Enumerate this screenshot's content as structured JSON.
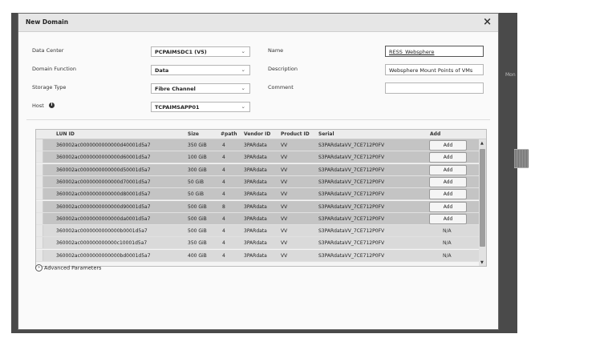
{
  "backdrop": {
    "text_right_top": "Mon"
  },
  "dialog": {
    "title": "New Domain",
    "close_label": "×",
    "form": {
      "data_center": {
        "label": "Data Center",
        "value": "PCPAIMSDC1 (V5)"
      },
      "domain_function": {
        "label": "Domain Function",
        "value": "Data"
      },
      "storage_type": {
        "label": "Storage Type",
        "value": "Fibre Channel"
      },
      "host": {
        "label": "Host",
        "value": "TCPAIMSAPP01"
      },
      "name": {
        "label": "Name",
        "value": "RESS_Websphere"
      },
      "description": {
        "label": "Description",
        "value": "Websphere Mount Points of VMs"
      },
      "comment": {
        "label": "Comment",
        "value": ""
      }
    },
    "lun_table": {
      "columns": [
        "LUN ID",
        "Size",
        "#path",
        "Vendor ID",
        "Product ID",
        "Serial",
        "Add"
      ],
      "rows": [
        {
          "lun_id": "360002ac0000000000000d40001d5a7",
          "size": "350 GiB",
          "paths": "4",
          "vendor": "3PARdata",
          "product": "VV",
          "serial": "S3PARdataVV_7CE712P0FV",
          "add": "Add",
          "addable": true
        },
        {
          "lun_id": "360002ac0000000000000d60001d5a7",
          "size": "100 GiB",
          "paths": "4",
          "vendor": "3PARdata",
          "product": "VV",
          "serial": "S3PARdataVV_7CE712P0FV",
          "add": "Add",
          "addable": true
        },
        {
          "lun_id": "360002ac0000000000000d50001d5a7",
          "size": "300 GiB",
          "paths": "4",
          "vendor": "3PARdata",
          "product": "VV",
          "serial": "S3PARdataVV_7CE712P0FV",
          "add": "Add",
          "addable": true
        },
        {
          "lun_id": "360002ac0000000000000d70001d5a7",
          "size": "50 GiB",
          "paths": "4",
          "vendor": "3PARdata",
          "product": "VV",
          "serial": "S3PARdataVV_7CE712P0FV",
          "add": "Add",
          "addable": true
        },
        {
          "lun_id": "360002ac0000000000000d80001d5a7",
          "size": "50 GiB",
          "paths": "4",
          "vendor": "3PARdata",
          "product": "VV",
          "serial": "S3PARdataVV_7CE712P0FV",
          "add": "Add",
          "addable": true
        },
        {
          "lun_id": "360002ac0000000000000d90001d5a7",
          "size": "500 GiB",
          "paths": "8",
          "vendor": "3PARdata",
          "product": "VV",
          "serial": "S3PARdataVV_7CE712P0FV",
          "add": "Add",
          "addable": true
        },
        {
          "lun_id": "360002ac0000000000000da0001d5a7",
          "size": "500 GiB",
          "paths": "4",
          "vendor": "3PARdata",
          "product": "VV",
          "serial": "S3PARdataVV_7CE712P0FV",
          "add": "Add",
          "addable": true
        },
        {
          "lun_id": "360002ac0000000000000b0001d5a7",
          "size": "500 GiB",
          "paths": "4",
          "vendor": "3PARdata",
          "product": "VV",
          "serial": "S3PARdataVV_7CE712P0FV",
          "add": "N/A",
          "addable": false
        },
        {
          "lun_id": "360002ac000000000000c10001d5a7",
          "size": "350 GiB",
          "paths": "4",
          "vendor": "3PARdata",
          "product": "VV",
          "serial": "S3PARdataVV_7CE712P0FV",
          "add": "N/A",
          "addable": false
        },
        {
          "lun_id": "360002ac0000000000000bd0001d5a7",
          "size": "400 GiB",
          "paths": "4",
          "vendor": "3PARdata",
          "product": "VV",
          "serial": "S3PARdataVV_7CE712P0FV",
          "add": "N/A",
          "addable": false
        }
      ]
    },
    "advanced_parameters_label": "Advanced Parameters"
  },
  "colors": {
    "backdrop": "#4a4a4a",
    "dialog_bg": "#fafafa",
    "row_addable": "#c4c4c4",
    "row_na": "#dadada"
  }
}
